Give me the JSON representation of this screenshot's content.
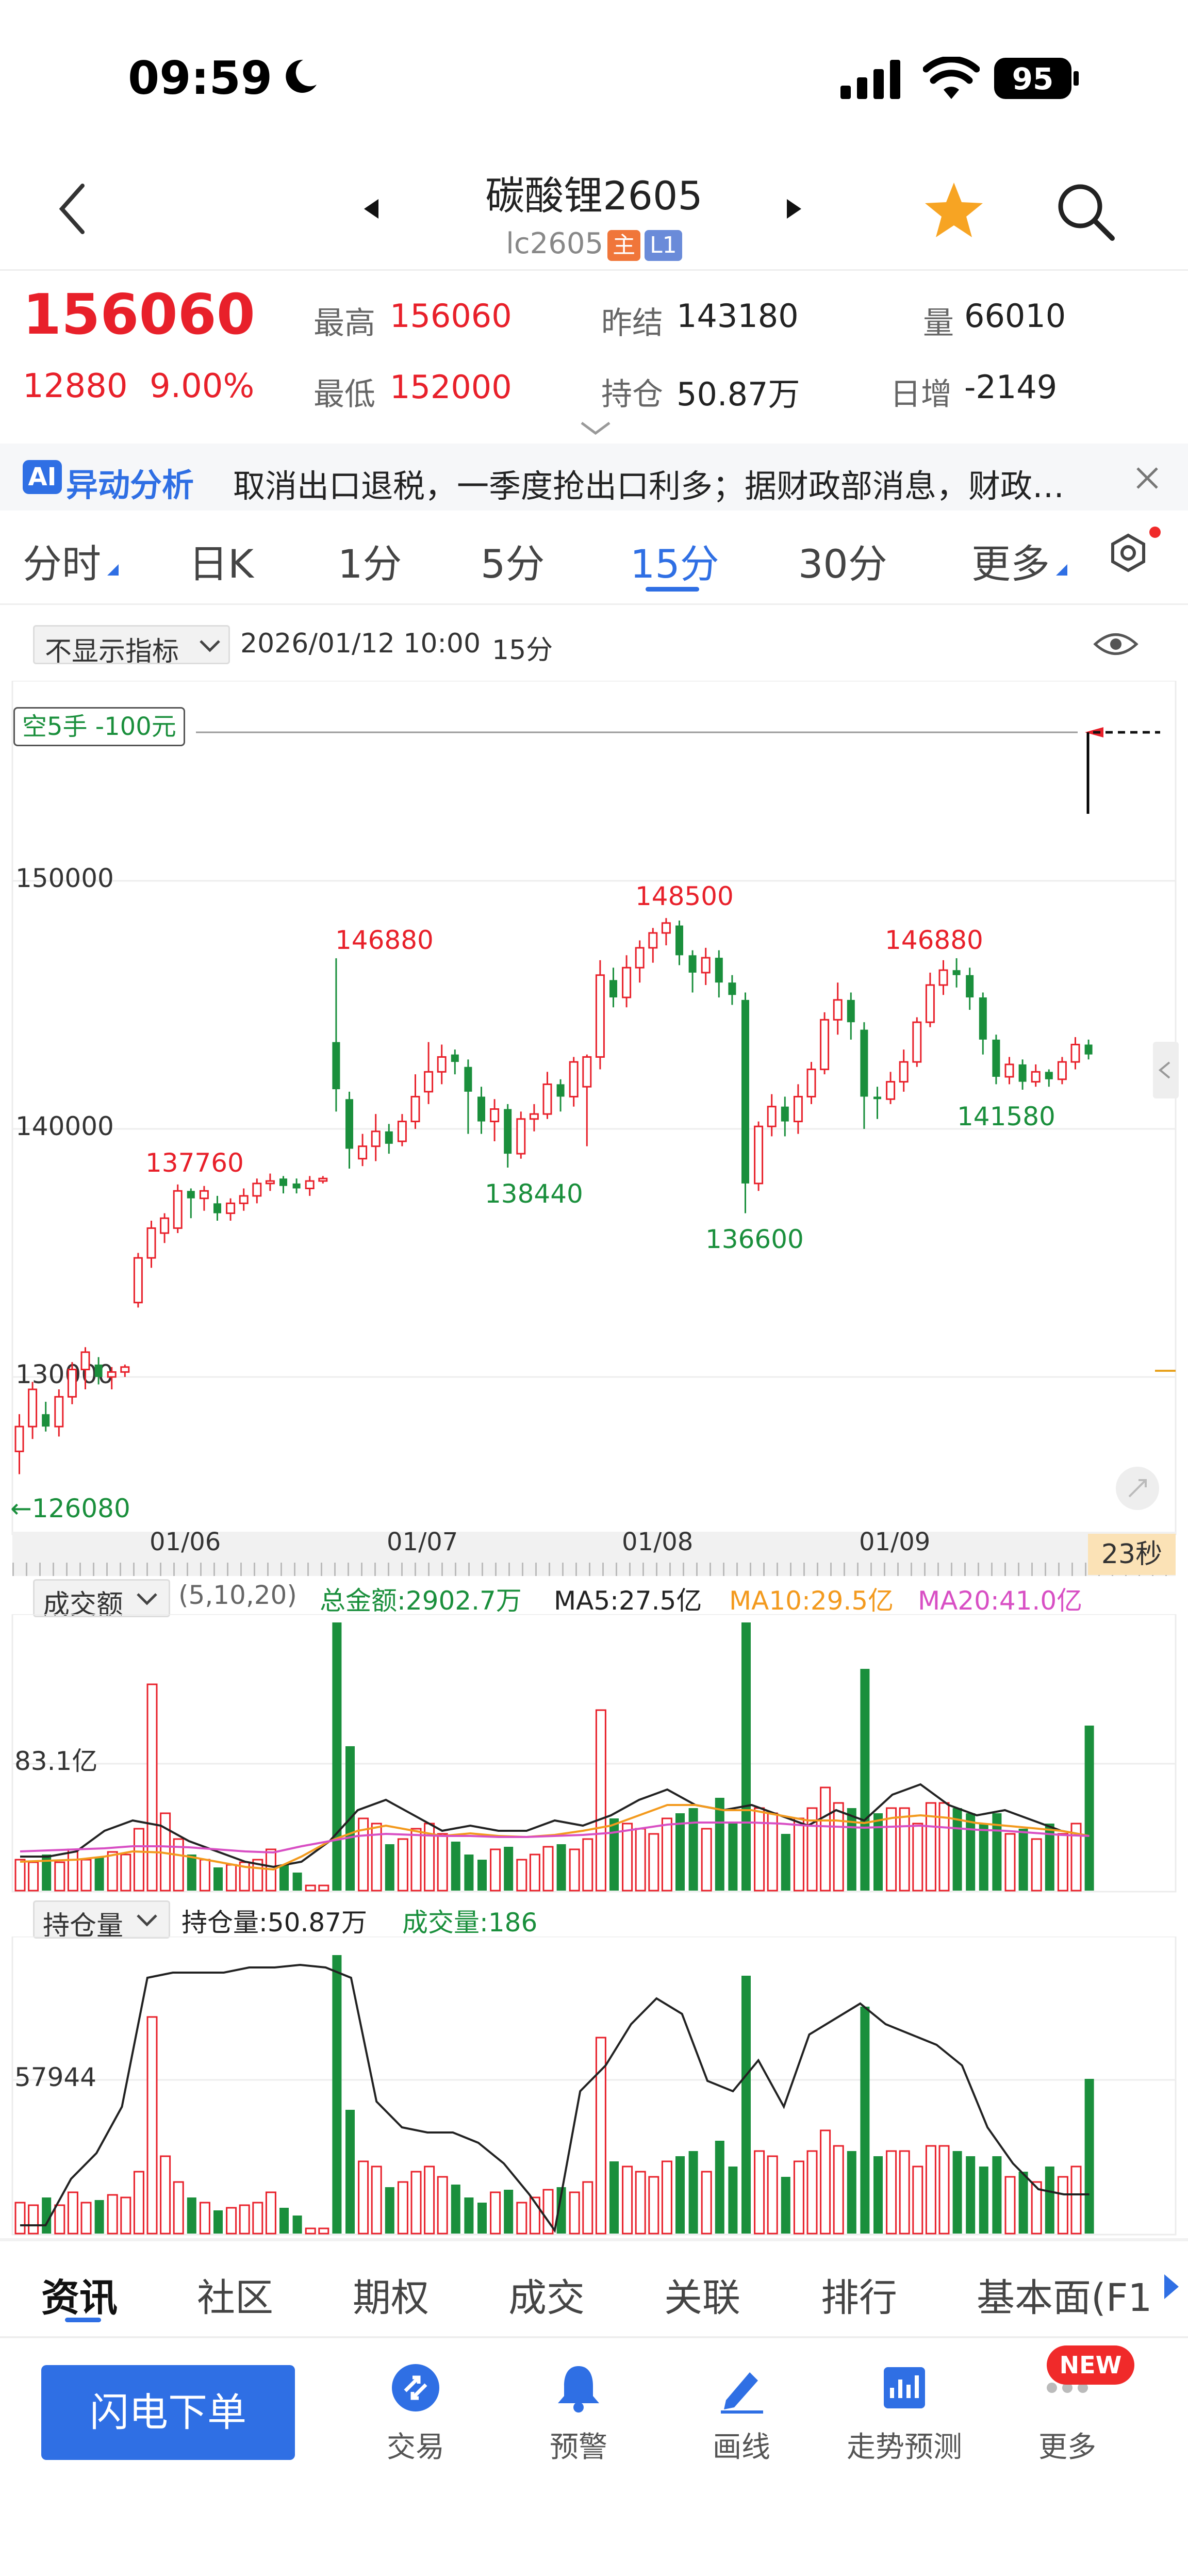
{
  "status": {
    "time": "09:59",
    "battery": "95"
  },
  "header": {
    "title": "碳酸锂2605",
    "code": "lc2605",
    "tag_main": "主",
    "tag_level": "L1"
  },
  "quote": {
    "price": "156060",
    "change": "12880",
    "change_pct": "9.00%",
    "high_label": "最高",
    "high": "156060",
    "low_label": "最低",
    "low": "152000",
    "prev_label": "昨结",
    "prev": "143180",
    "oi_label": "持仓",
    "oi": "50.87万",
    "vol_label": "量",
    "vol": "66010",
    "daily_label": "日增",
    "daily": "-2149"
  },
  "news": {
    "badge": "AI",
    "label": "异动分析",
    "text": "取消出口退税，一季度抢出口利多；据财政部消息，财政…"
  },
  "tabs": [
    {
      "label": "分时"
    },
    {
      "label": "日K"
    },
    {
      "label": "1分"
    },
    {
      "label": "5分"
    },
    {
      "label": "15分"
    },
    {
      "label": "30分"
    },
    {
      "label": "更多"
    }
  ],
  "chart_header": {
    "indicator": "不显示指标",
    "datetime": "2026/01/12 10:00",
    "period": "15分"
  },
  "position_tag": "空5手 -100元",
  "price_axis": [
    "150000",
    "140000",
    "130000"
  ],
  "annotations": [
    "146880",
    "148500",
    "146880",
    "137760",
    "138440",
    "136600",
    "141580",
    "←126080"
  ],
  "date_labels": [
    "01/06",
    "01/07",
    "01/08",
    "01/09"
  ],
  "countdown": "23秒",
  "volume_panel": {
    "selector": "成交额",
    "params": "(5,10,20)",
    "total": "总金额:2902.7万",
    "ma5": "MA5:27.5亿",
    "ma10": "MA10:29.5亿",
    "ma20": "MA20:41.0亿",
    "axis": "83.1亿"
  },
  "oi_panel": {
    "selector": "持仓量",
    "oi": "持仓量:50.87万",
    "vol": "成交量:186",
    "axis": "57944"
  },
  "bottom_tabs": [
    {
      "label": "资讯"
    },
    {
      "label": "社区"
    },
    {
      "label": "期权"
    },
    {
      "label": "成交"
    },
    {
      "label": "关联"
    },
    {
      "label": "排行"
    },
    {
      "label": "基本面(F1"
    }
  ],
  "toolbar": {
    "order_button": "闪电下单",
    "items": [
      {
        "label": "交易"
      },
      {
        "label": "预警"
      },
      {
        "label": "画线"
      },
      {
        "label": "走势预测"
      },
      {
        "label": "更多"
      }
    ],
    "new_badge": "NEW"
  },
  "colors": {
    "up": "#e8202a",
    "down": "#1a8f3c",
    "accent": "#2f6fe4",
    "ma5": "#222222",
    "ma10": "#f39a1e",
    "ma20": "#d84fc4"
  },
  "chart_data": {
    "type": "candlestick",
    "interval": "15分",
    "ylim": [
      125000,
      159000
    ],
    "candles": [
      [
        127000,
        128000,
        126080,
        128500
      ],
      [
        128000,
        129500,
        127500,
        129800
      ],
      [
        128500,
        128000,
        127800,
        129000
      ],
      [
        128000,
        129200,
        127600,
        129500
      ],
      [
        129200,
        130300,
        128900,
        130600
      ],
      [
        130300,
        131000,
        129500,
        131200
      ],
      [
        130500,
        130000,
        129700,
        130800
      ],
      [
        130000,
        130200,
        129500,
        130400
      ],
      [
        130200,
        130400,
        130000,
        130500
      ],
      [
        133000,
        134800,
        132800,
        135000
      ],
      [
        134800,
        136000,
        134400,
        136300
      ],
      [
        135800,
        136400,
        135400,
        136600
      ],
      [
        136000,
        137500,
        135800,
        137760
      ],
      [
        137500,
        137200,
        136400,
        137600
      ],
      [
        137200,
        137500,
        136700,
        137700
      ],
      [
        137000,
        136600,
        136300,
        137300
      ],
      [
        136600,
        137000,
        136300,
        137200
      ],
      [
        137000,
        137300,
        136700,
        137600
      ],
      [
        137300,
        137800,
        137000,
        138000
      ],
      [
        137800,
        137900,
        137500,
        138200
      ],
      [
        138000,
        137700,
        137400,
        138100
      ],
      [
        137800,
        137600,
        137400,
        138000
      ],
      [
        137600,
        137900,
        137300,
        138100
      ],
      [
        137900,
        138000,
        137800,
        138100
      ],
      [
        143500,
        141600,
        140700,
        146880
      ],
      [
        141200,
        139200,
        138400,
        141500
      ],
      [
        138800,
        139300,
        138500,
        139800
      ],
      [
        139300,
        139900,
        138700,
        140600
      ],
      [
        139900,
        139400,
        139000,
        140200
      ],
      [
        139500,
        140300,
        139300,
        140600
      ],
      [
        140300,
        141300,
        140000,
        142200
      ],
      [
        141500,
        142300,
        141000,
        143500
      ],
      [
        142300,
        142900,
        141800,
        143400
      ],
      [
        143000,
        142700,
        142200,
        143200
      ],
      [
        142500,
        141500,
        139800,
        142800
      ],
      [
        141300,
        140300,
        139800,
        141700
      ],
      [
        140300,
        140800,
        139500,
        141200
      ],
      [
        140800,
        139000,
        138440,
        141000
      ],
      [
        139000,
        140400,
        138800,
        140700
      ],
      [
        140400,
        140600,
        139900,
        141000
      ],
      [
        140600,
        141800,
        140400,
        142300
      ],
      [
        141800,
        141300,
        140700,
        142000
      ],
      [
        141300,
        142700,
        140900,
        142900
      ],
      [
        141700,
        142900,
        139300,
        143000
      ],
      [
        142900,
        146200,
        142400,
        146800
      ],
      [
        146000,
        145300,
        144900,
        146500
      ],
      [
        145300,
        146500,
        144900,
        147000
      ],
      [
        146500,
        147300,
        145900,
        147600
      ],
      [
        147300,
        147900,
        146700,
        148100
      ],
      [
        147900,
        148300,
        147400,
        148500
      ],
      [
        148200,
        147000,
        146600,
        148400
      ],
      [
        147000,
        146300,
        145500,
        147200
      ],
      [
        146300,
        146900,
        145800,
        147300
      ],
      [
        146900,
        145900,
        145300,
        147200
      ],
      [
        145900,
        145400,
        145000,
        146200
      ],
      [
        145200,
        137800,
        136600,
        145500
      ],
      [
        137800,
        140100,
        137500,
        140300
      ],
      [
        140100,
        140900,
        139700,
        141400
      ],
      [
        140900,
        140300,
        139700,
        141300
      ],
      [
        140300,
        141300,
        139800,
        141800
      ],
      [
        141300,
        142400,
        141000,
        142700
      ],
      [
        142400,
        144400,
        142200,
        144700
      ],
      [
        144400,
        145200,
        143800,
        145900
      ],
      [
        145200,
        144300,
        143600,
        145500
      ],
      [
        144000,
        141300,
        140000,
        144300
      ],
      [
        141300,
        141200,
        140400,
        141700
      ],
      [
        141200,
        141900,
        141000,
        142300
      ],
      [
        141900,
        142700,
        141500,
        143200
      ],
      [
        142700,
        144300,
        142500,
        144500
      ],
      [
        144300,
        145800,
        144100,
        146300
      ],
      [
        145800,
        146400,
        145400,
        146800
      ],
      [
        146400,
        146200,
        145700,
        146880
      ],
      [
        146200,
        145300,
        144800,
        146500
      ],
      [
        145300,
        143600,
        143000,
        145500
      ],
      [
        143600,
        142100,
        141800,
        143800
      ],
      [
        142100,
        142600,
        141800,
        142900
      ],
      [
        142600,
        141900,
        141580,
        142800
      ],
      [
        141900,
        142300,
        141700,
        142600
      ],
      [
        142300,
        142000,
        141700,
        142400
      ],
      [
        142000,
        142700,
        141800,
        142900
      ],
      [
        142700,
        143400,
        142400,
        143700
      ],
      [
        143400,
        143000,
        142800,
        143600
      ]
    ]
  }
}
